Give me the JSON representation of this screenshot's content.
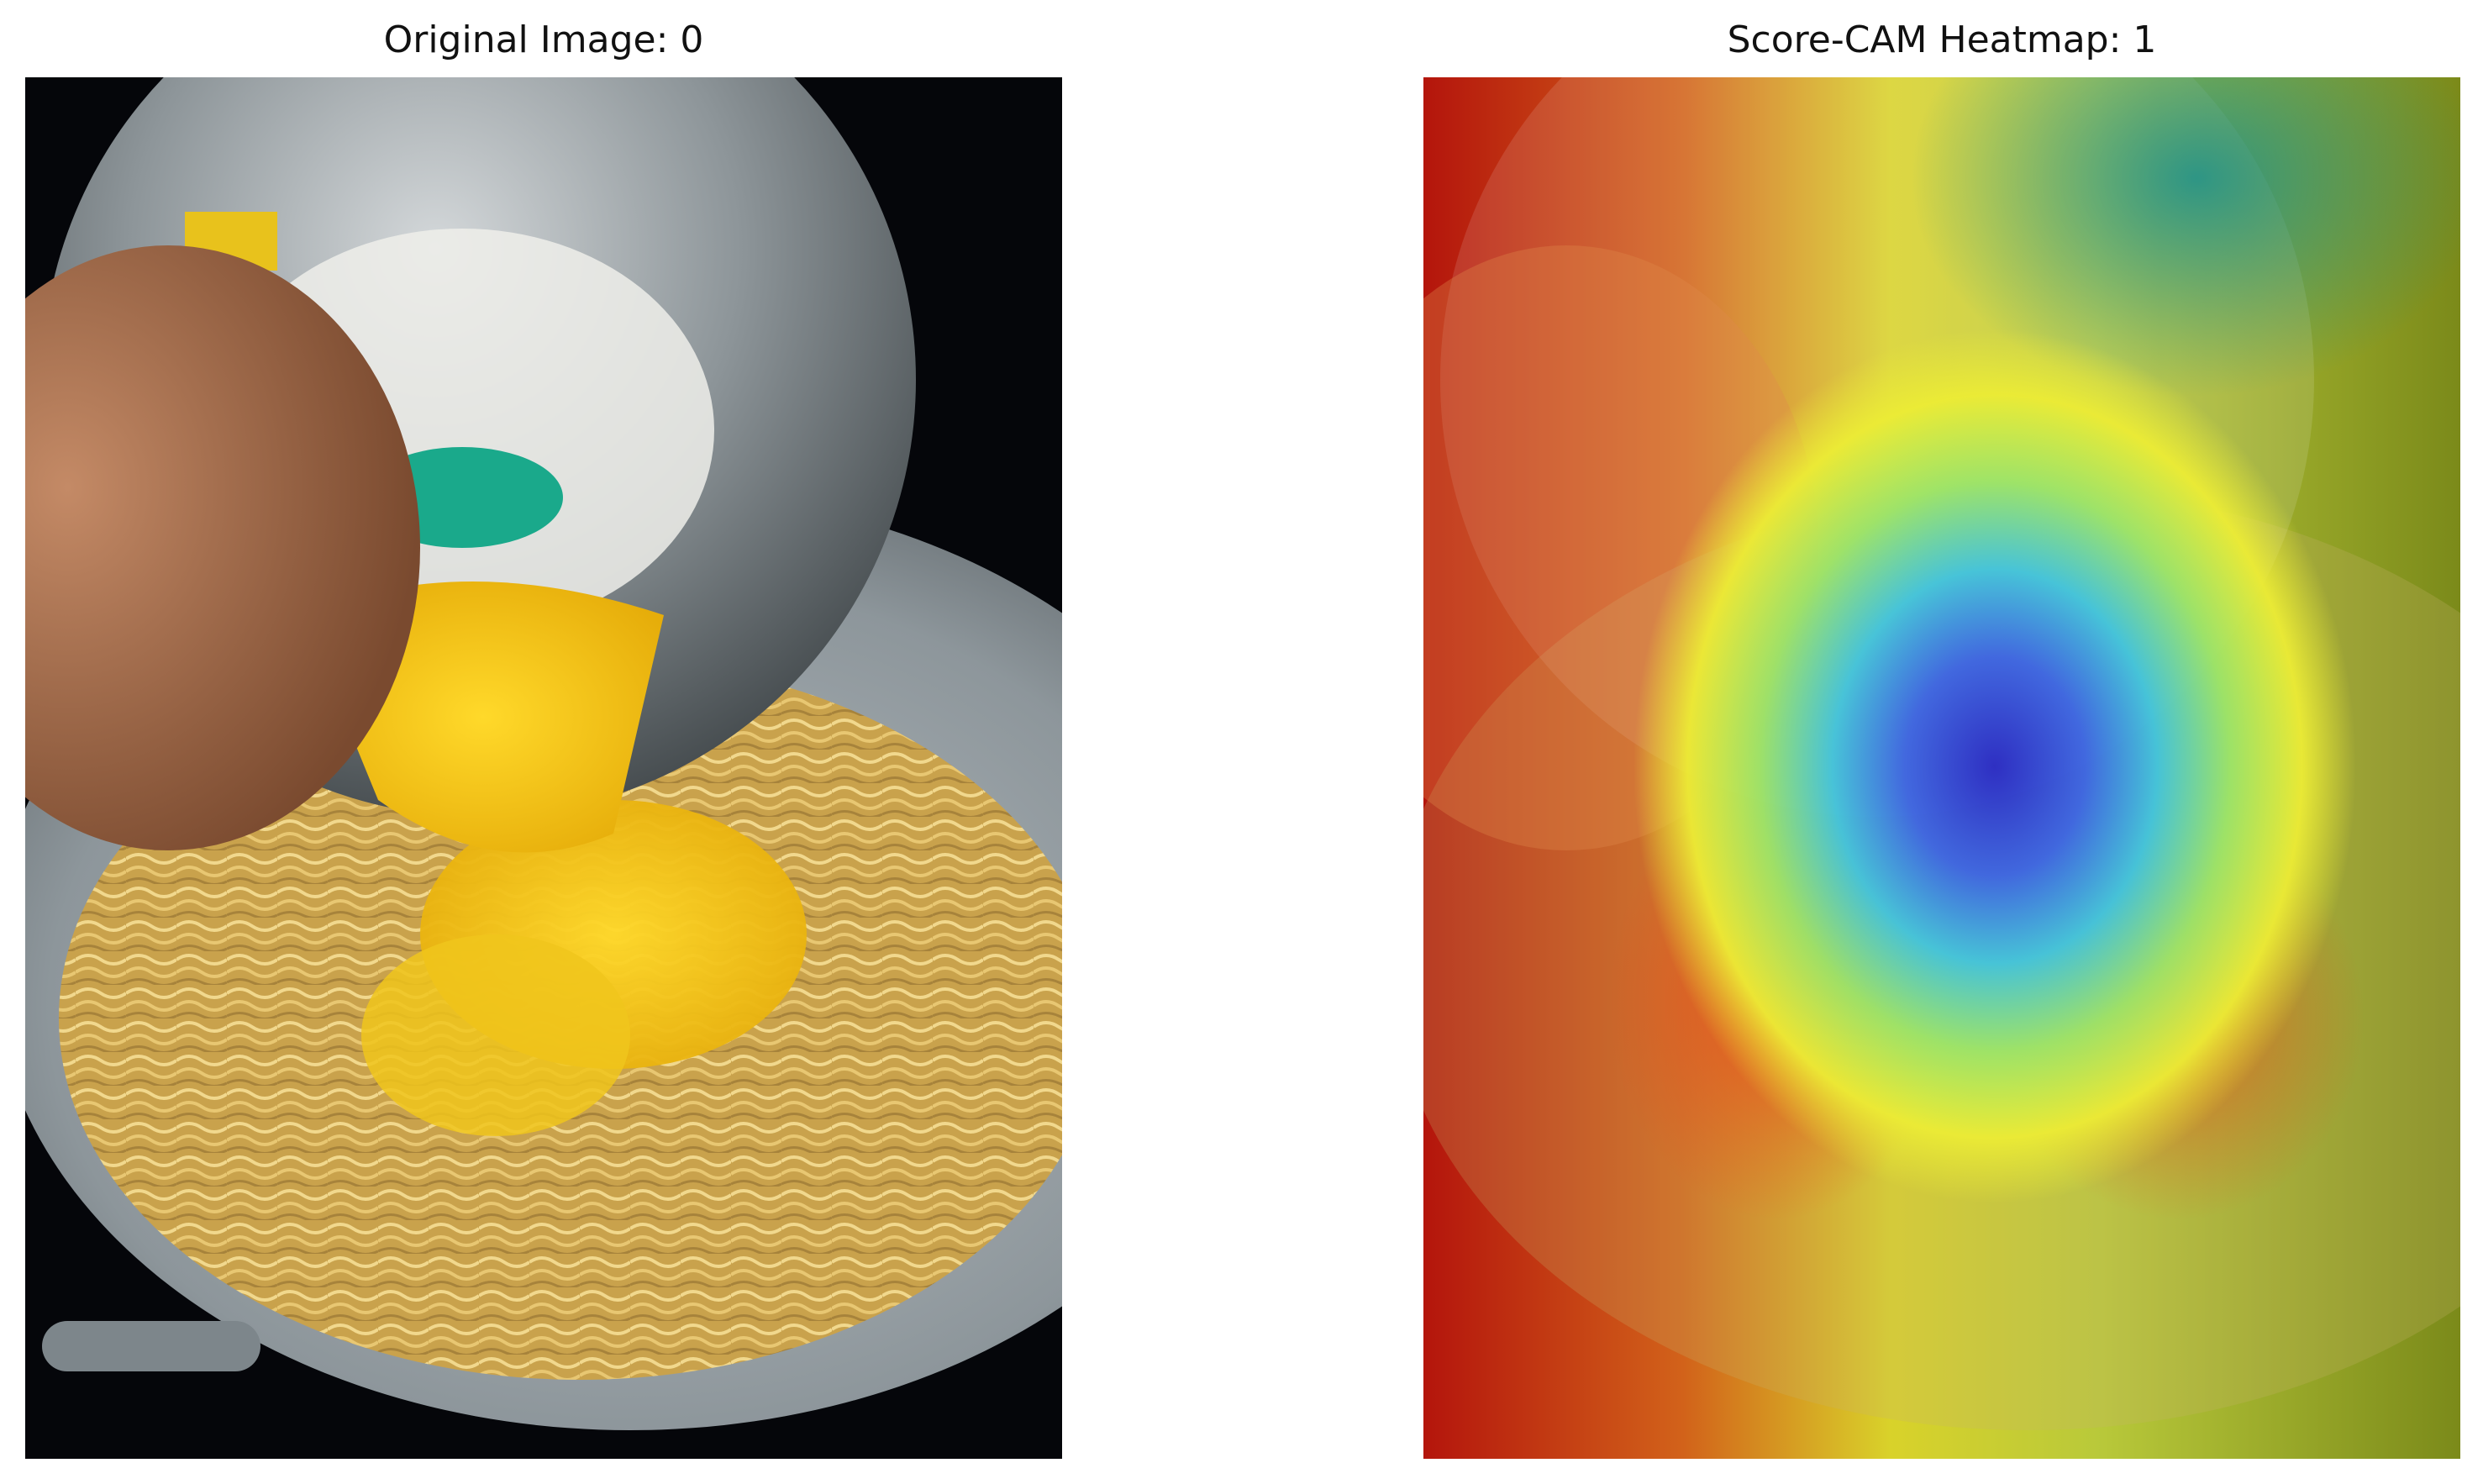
{
  "panels": {
    "left": {
      "title": "Original Image: 0",
      "image": "photo of spaghetti in a pan with yellow sauce poured from a metal bowl"
    },
    "right": {
      "title": "Score-CAM Heatmap: 1",
      "image": "same photo overlaid with jet colormap heatmap, blue/violet hotspot at center"
    }
  },
  "colors": {
    "background": "#000000",
    "pan": "#8a9499",
    "noodles": "#d9b45a",
    "sauce": "#f3c514",
    "hand": "#a9714f",
    "bowl": "#9aa3a8",
    "sponge": "#1aa98b",
    "heat_red": "#c31a0f",
    "heat_yellow": "#f0e02a",
    "heat_cyan": "#65d9c6",
    "heat_blue": "#2a2fd6"
  }
}
